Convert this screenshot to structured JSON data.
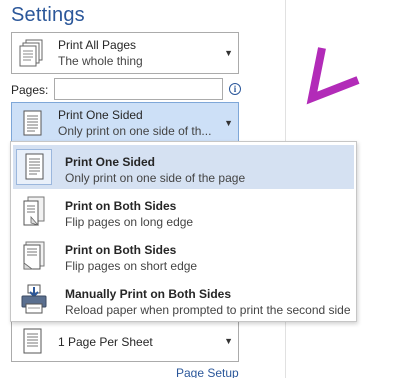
{
  "settings": {
    "title": "Settings"
  },
  "print_what": {
    "label": "Print All Pages",
    "description": "The whole thing"
  },
  "pages": {
    "label": "Pages:",
    "value": "",
    "info_icon": "info-icon"
  },
  "sides": {
    "label": "Print One Sided",
    "description": "Only print on one side of th..."
  },
  "sides_menu": {
    "items": [
      {
        "label": "Print One Sided",
        "description": "Only print on one side of the page",
        "icon": "one-sided-page-icon"
      },
      {
        "label": "Print on Both Sides",
        "description": "Flip pages on long edge",
        "icon": "duplex-long-edge-icon"
      },
      {
        "label": "Print on Both Sides",
        "description": "Flip pages on short edge",
        "icon": "duplex-short-edge-icon"
      },
      {
        "label": "Manually Print on Both Sides",
        "description": "Reload paper when prompted to print the second side",
        "icon": "manual-duplex-printer-icon"
      }
    ]
  },
  "pages_per_sheet": {
    "label": "1 Page Per Sheet"
  },
  "page_setup": {
    "label": "Page Setup"
  },
  "colors": {
    "accent": "#2b579a",
    "selected_bg": "#cde0f7",
    "highlight_bg": "#d5e1f2",
    "arrow": "#b22bb8"
  }
}
